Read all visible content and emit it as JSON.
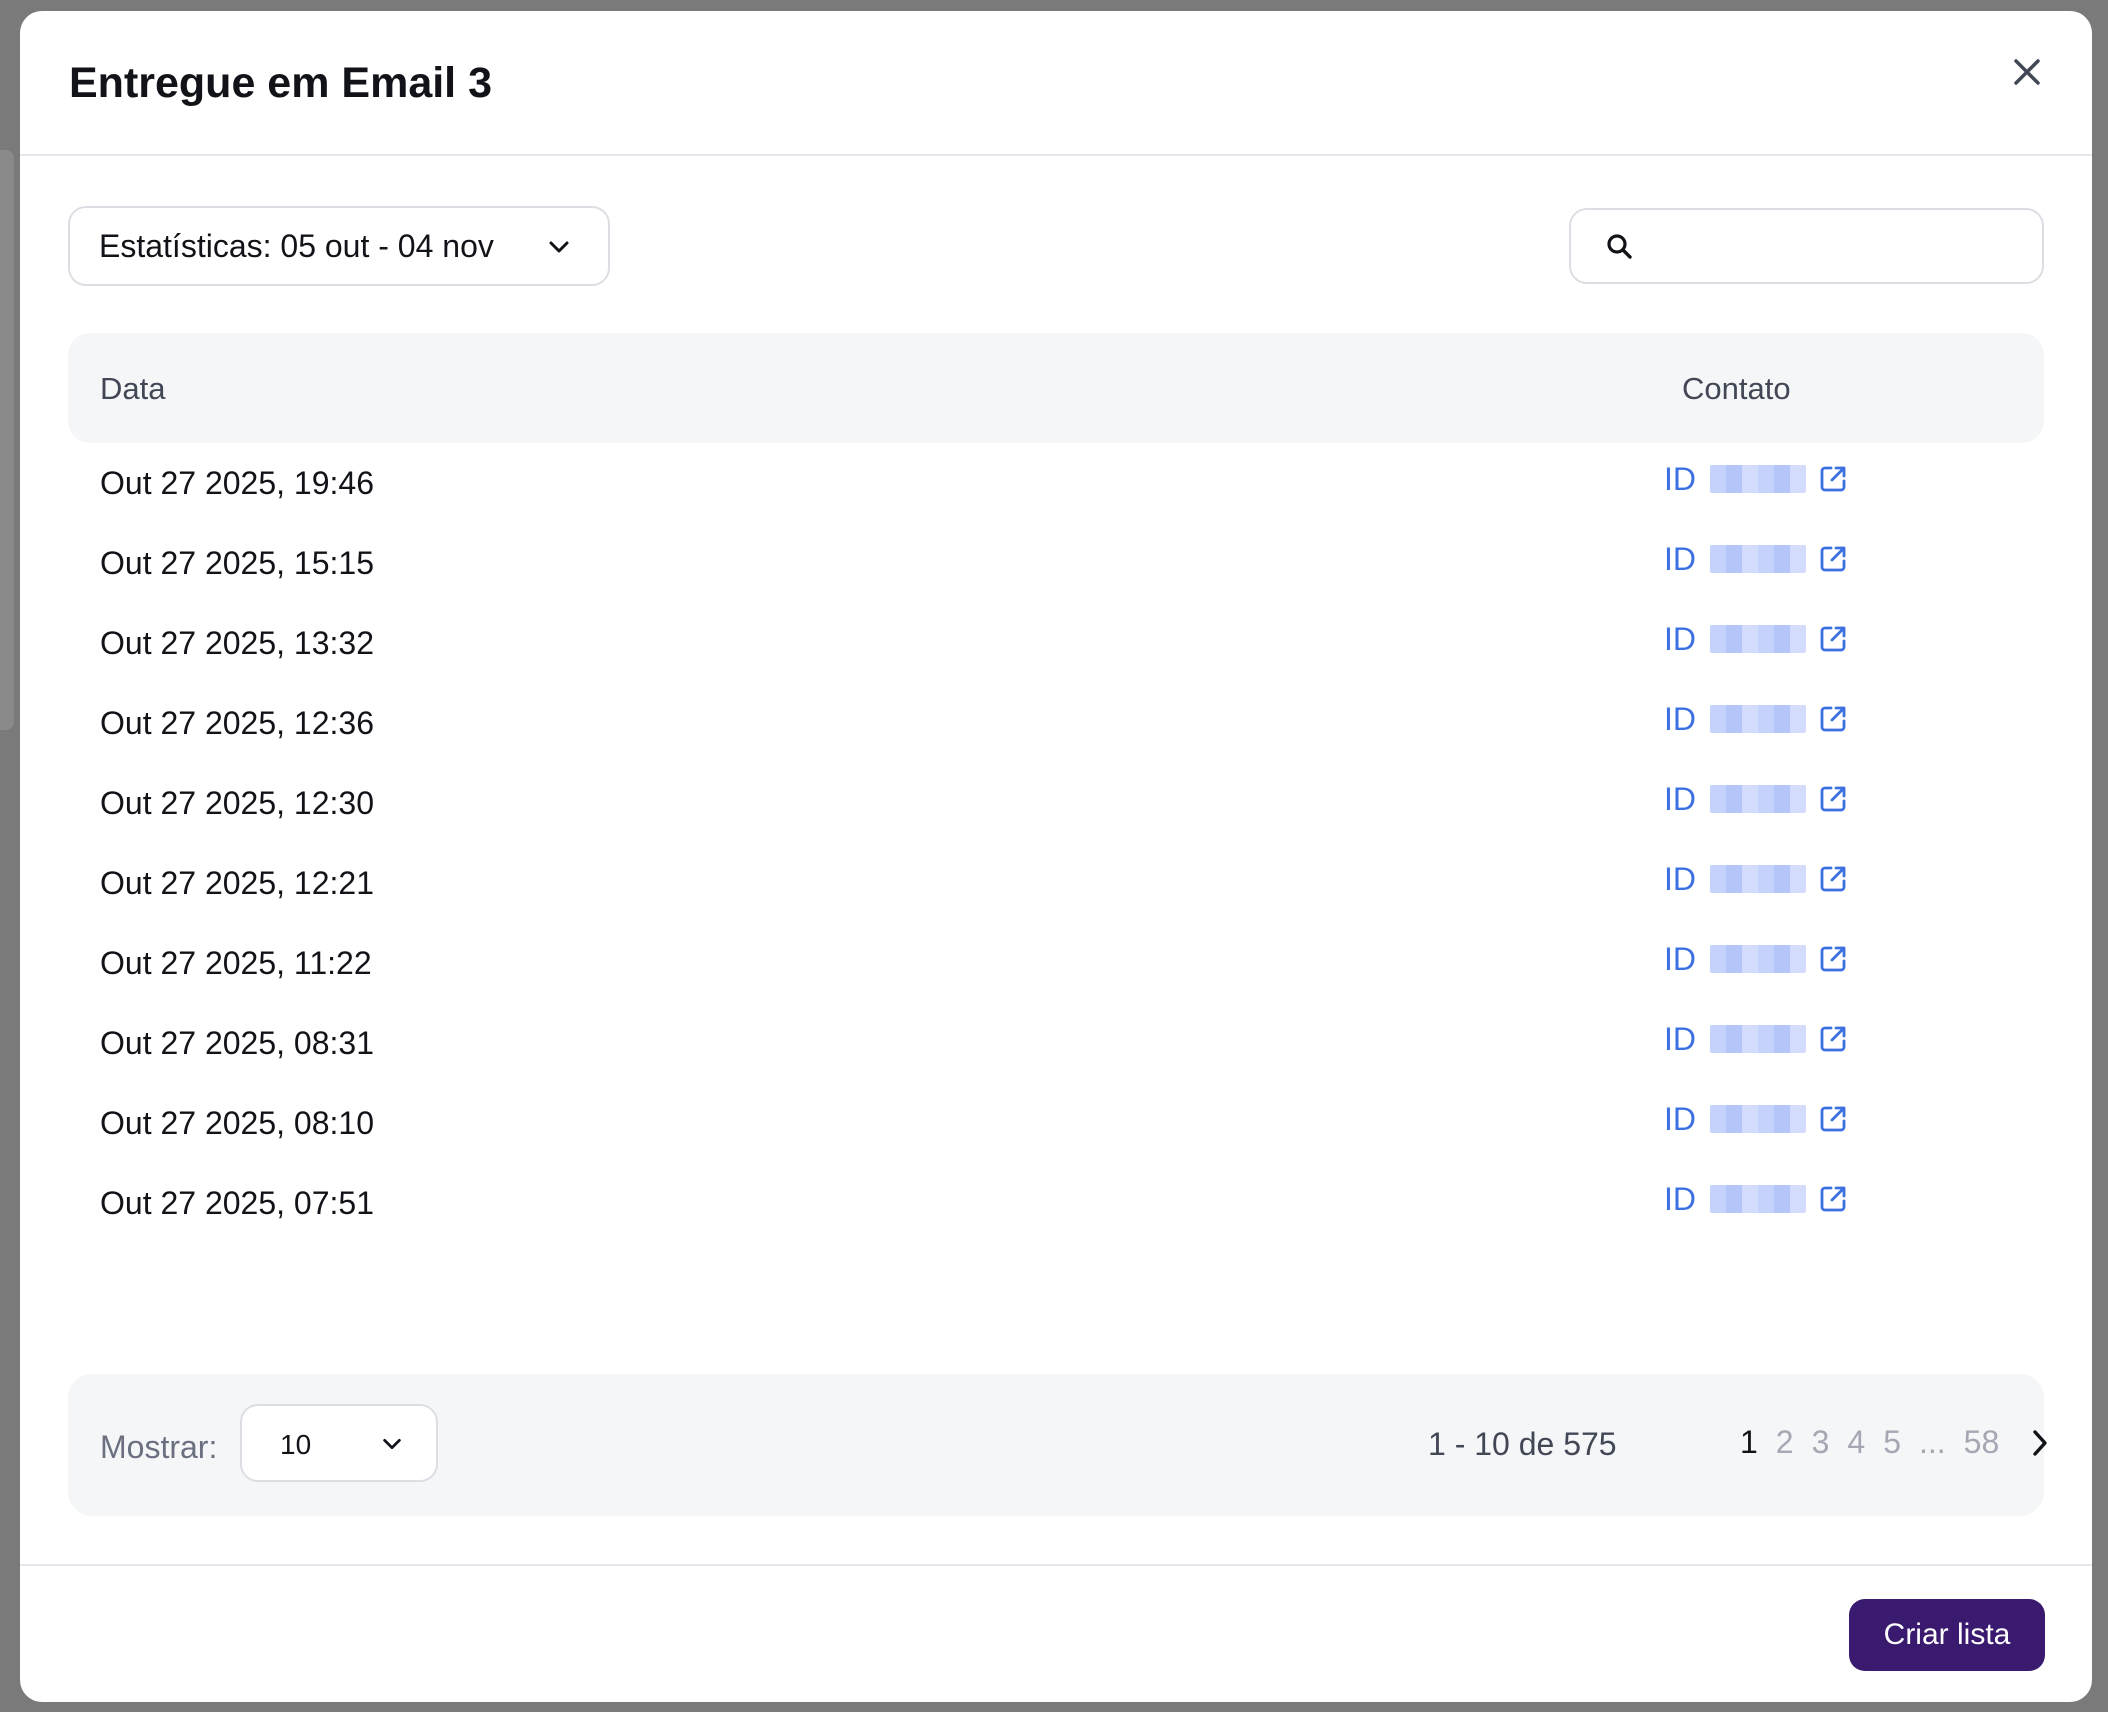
{
  "modal": {
    "title": "Entregue em Email 3"
  },
  "filters": {
    "date_range_label": "Estatísticas: 05 out - 04 nov",
    "search_placeholder": ""
  },
  "table": {
    "headers": {
      "date": "Data",
      "contact": "Contato"
    },
    "rows": [
      {
        "date": "Out 27 2025, 19:46",
        "contact_prefix": "ID"
      },
      {
        "date": "Out 27 2025, 15:15",
        "contact_prefix": "ID"
      },
      {
        "date": "Out 27 2025, 13:32",
        "contact_prefix": "ID"
      },
      {
        "date": "Out 27 2025, 12:36",
        "contact_prefix": "ID"
      },
      {
        "date": "Out 27 2025, 12:30",
        "contact_prefix": "ID"
      },
      {
        "date": "Out 27 2025, 12:21",
        "contact_prefix": "ID"
      },
      {
        "date": "Out 27 2025, 11:22",
        "contact_prefix": "ID"
      },
      {
        "date": "Out 27 2025, 08:31",
        "contact_prefix": "ID"
      },
      {
        "date": "Out 27 2025, 08:10",
        "contact_prefix": "ID"
      },
      {
        "date": "Out 27 2025, 07:51",
        "contact_prefix": "ID"
      }
    ]
  },
  "pagination": {
    "show_label": "Mostrar:",
    "page_size": "10",
    "range_text": "1 - 10 de 575",
    "pages": [
      "1",
      "2",
      "3",
      "4",
      "5"
    ],
    "ellipsis": "...",
    "last_page": "58",
    "current_page": "1"
  },
  "footer": {
    "create_list_label": "Criar lista"
  },
  "icons": {
    "close": "close-icon",
    "dropdown": "chevron-down-icon",
    "search": "search-icon",
    "external_link": "external-link-icon",
    "next": "chevron-right-icon"
  },
  "colors": {
    "primary_button": "#3a1a6e",
    "link": "#3c6fe0",
    "text": "#111318",
    "muted": "#a4a8b3"
  }
}
